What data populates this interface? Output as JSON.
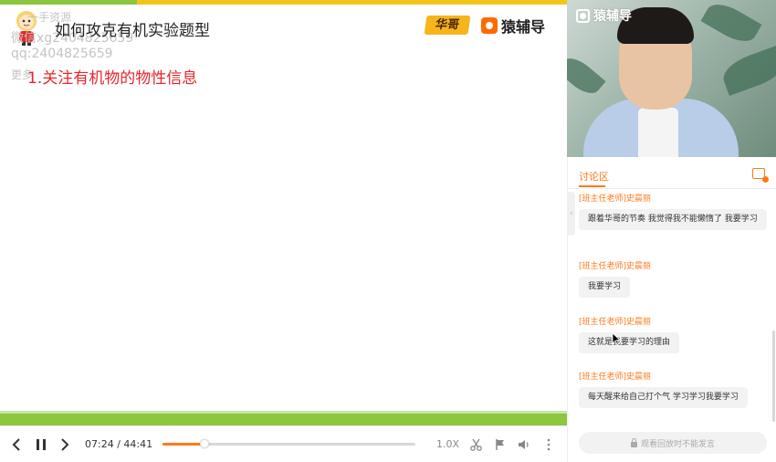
{
  "slide": {
    "title": "如何攻克有机实验题型",
    "heading": "1.关注有机物的物性信息",
    "watermark_top": "一手资源",
    "watermark_wechat": "微信xg2404825659",
    "watermark_qq": "qq:2404825659",
    "watermark_more": "更多",
    "tag": "华哥",
    "brand": "猿辅导"
  },
  "player": {
    "current_time": "07:24",
    "separator": "/",
    "total_time": "44:41",
    "progress_fraction": 0.166,
    "speed": "1.0X"
  },
  "video": {
    "brand": "猿辅导"
  },
  "chat": {
    "tab_label": "讨论区",
    "messages": [
      {
        "name": "[班主任老师]史晨丽",
        "text": "跟着华哥的节奏 我觉得我不能懒惰了 我要学习"
      },
      {
        "name": "[班主任老师]史晨丽",
        "text": "我要学习"
      },
      {
        "name": "[班主任老师]史晨丽",
        "text": "这就是我要学习的理由"
      },
      {
        "name": "[班主任老师]史晨丽",
        "text": "每天醒来给自己打个气 学习学习我要学习"
      }
    ],
    "input_placeholder": "观看回放时不能发言"
  },
  "colors": {
    "accent": "#ff7a1a",
    "slide_green": "#8dc63f",
    "slide_yellow": "#f3c51c",
    "heading_red": "#e8262a"
  },
  "icons": {
    "prev": "chevron-left-icon",
    "pause": "pause-icon",
    "next": "chevron-right-icon",
    "clip": "scissors-icon",
    "mark": "flag-icon",
    "volume": "volume-icon",
    "more": "more-vertical-icon",
    "lock": "lock-icon"
  }
}
